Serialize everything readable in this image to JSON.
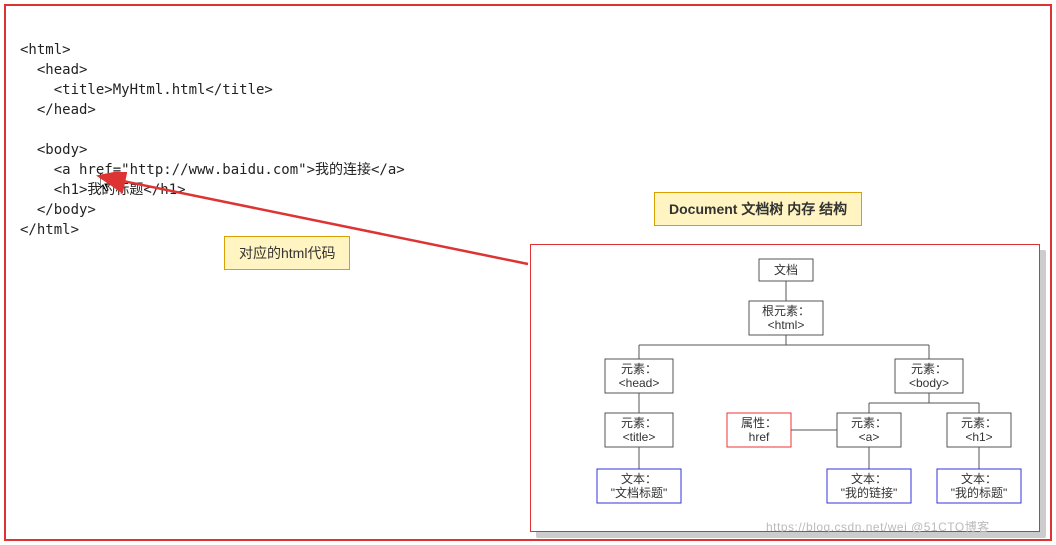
{
  "code_lines": "<html>\n  <head>\n    <title>MyHtml.html</title>\n  </head>\n\n  <body>\n    <a href=\"http://www.baidu.com\">我的连接</a>\n    <h1>我的标题</h1>\n  </body>\n</html>",
  "callouts": {
    "html_code": "对应的html代码",
    "doc_tree": "Document 文档树 内存 结构"
  },
  "tree": {
    "root": "文档",
    "html": {
      "line1": "根元素：",
      "line2": "<html>"
    },
    "head": {
      "line1": "元素：",
      "line2": "<head>"
    },
    "body": {
      "line1": "元素：",
      "line2": "<body>"
    },
    "title": {
      "line1": "元素：",
      "line2": "<title>"
    },
    "href": {
      "line1": "属性：",
      "line2": "href"
    },
    "a": {
      "line1": "元素：",
      "line2": "<a>"
    },
    "h1": {
      "line1": "元素：",
      "line2": "<h1>"
    },
    "txt_title": {
      "line1": "文本：",
      "line2": "\"文档标题\""
    },
    "txt_link": {
      "line1": "文本：",
      "line2": "\"我的链接\""
    },
    "txt_head": {
      "line1": "文本：",
      "line2": "\"我的标题\""
    }
  },
  "watermark": "https://blog.csdn.net/wei @51CTO博客"
}
